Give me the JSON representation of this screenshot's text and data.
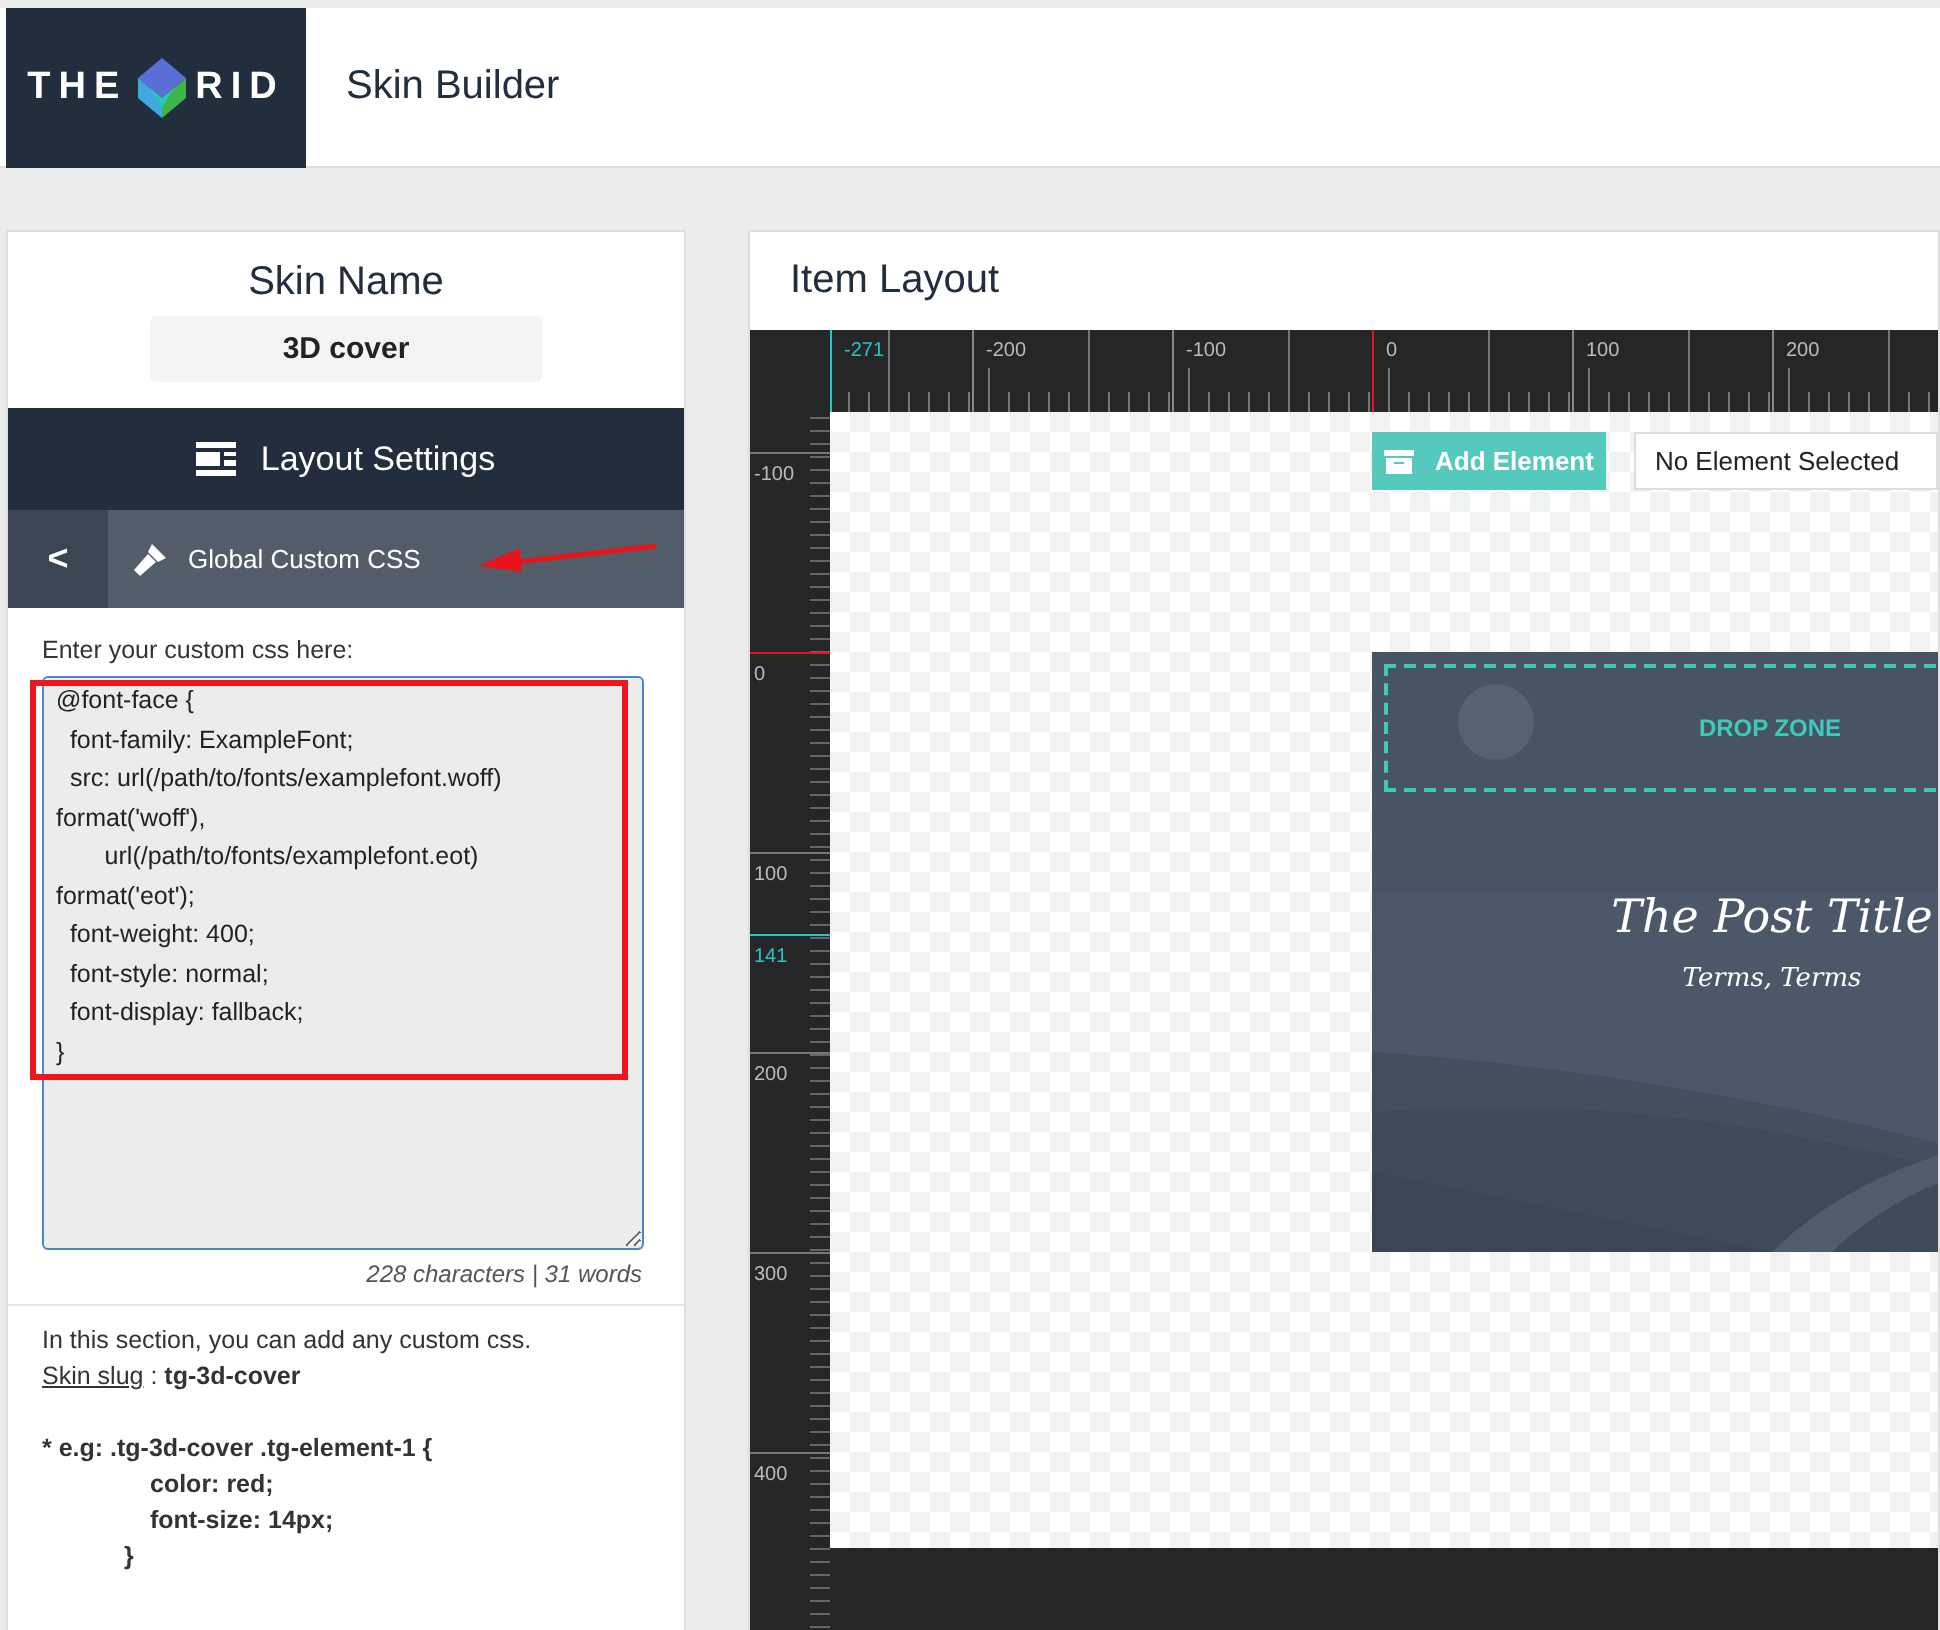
{
  "header": {
    "logo": {
      "left": "THE",
      "right": "RID"
    },
    "title": "Skin Builder"
  },
  "sidebar": {
    "skin_name_label": "Skin Name",
    "skin_name_value": "3D cover",
    "section_title": "Layout Settings",
    "back_label": "<",
    "subsection_title": "Global Custom CSS",
    "field_label": "Enter your custom css here:",
    "css_lines": [
      "@font-face {",
      "  font-family: ExampleFont;",
      "  src: url(/path/to/fonts/examplefont.woff)",
      "format('woff'),",
      "       url(/path/to/fonts/examplefont.eot)",
      "format('eot');",
      "  font-weight: 400;",
      "  font-style: normal;",
      "  font-display: fallback;",
      "}"
    ],
    "counter": "228 characters | 31 words",
    "help_text": "In this section, you can add any custom css.",
    "slug_link": "Skin slug",
    "slug_separator": " : ",
    "slug_value": "tg-3d-cover",
    "example_lines": [
      "* e.g: .tg-3d-cover .tg-element-1 {",
      "color: red;",
      "font-size: 14px;",
      "}"
    ]
  },
  "annotations": {
    "highlight_box": true,
    "arrow": true
  },
  "layout": {
    "title": "Item Layout",
    "ruler_x": [
      {
        "label": "-271",
        "kind": "edge"
      },
      {
        "label": "-200",
        "kind": "major"
      },
      {
        "label": "-100",
        "kind": "major"
      },
      {
        "label": "0",
        "kind": "origin"
      },
      {
        "label": "100",
        "kind": "major"
      },
      {
        "label": "200",
        "kind": "major"
      }
    ],
    "ruler_y": [
      {
        "label": "-100",
        "kind": "major"
      },
      {
        "label": "0",
        "kind": "origin"
      },
      {
        "label": "100",
        "kind": "major"
      },
      {
        "label": "141",
        "kind": "edge"
      },
      {
        "label": "200",
        "kind": "major"
      },
      {
        "label": "300",
        "kind": "major"
      },
      {
        "label": "400",
        "kind": "major"
      }
    ],
    "add_button": "Add Element",
    "selection": "No Element Selected",
    "card": {
      "kind": "picture",
      "drop_zone": "DROP ZONE",
      "post_title": "The Post Title",
      "terms": "Terms, Terms"
    }
  }
}
